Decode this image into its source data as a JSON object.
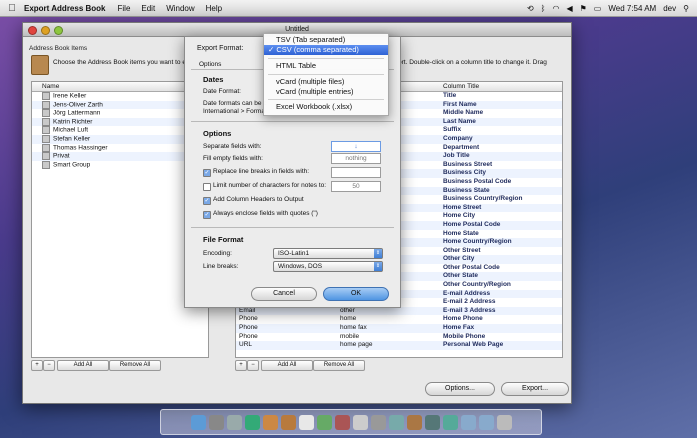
{
  "menubar": {
    "apple": "",
    "app_name": "Export Address Book",
    "items": [
      "File",
      "Edit",
      "Window",
      "Help"
    ],
    "clock": "Wed 7:54 AM",
    "user": "dev"
  },
  "window": {
    "title": "Untitled",
    "left_pane_label": "Address Book Items",
    "instructions": "Choose the Address Book items you want to ex",
    "instructions_end": "ort. Double-click on a column title to change it. Drag",
    "name_header": "Name",
    "contacts": [
      "Irene Keller",
      "Jens-Oliver Zarth",
      "Jörg Lattermann",
      "Katrin Richter",
      "Michael Luft",
      "Stefan Keller",
      "Thomas Hassinger",
      "Privat",
      "Smart Group"
    ],
    "add_all": "Add All",
    "remove_all": "Remove All",
    "plus": "+",
    "minus": "−",
    "column_title_header": "Column Title",
    "column_titles": [
      "Title",
      "First Name",
      "Middle Name",
      "Last Name",
      "Suffix",
      "Company",
      "Department",
      "Job Title",
      "Business Street",
      "Business City",
      "Business Postal Code",
      "Business State",
      "Business Country/Region",
      "Home Street",
      "Home City",
      "Home Postal Code",
      "Home State",
      "Home Country/Region",
      "Other Street",
      "Other City",
      "Other Postal Code",
      "Other State",
      "Other Country/Region",
      "E-mail Address",
      "E-mail 2 Address",
      "E-mail 3 Address",
      "Home Phone",
      "Home Fax",
      "Mobile Phone",
      "Personal Web Page"
    ],
    "lower_rows": [
      {
        "field": "Email",
        "label": "home"
      },
      {
        "field": "Email",
        "label": "other"
      },
      {
        "field": "Phone",
        "label": "home"
      },
      {
        "field": "Phone",
        "label": "home fax"
      },
      {
        "field": "Phone",
        "label": "mobile"
      },
      {
        "field": "URL",
        "label": "home page"
      }
    ],
    "options_button": "Options...",
    "export_button": "Export..."
  },
  "sheet": {
    "export_format_label": "Export Format:",
    "tab_options": "Options",
    "dates_header": "Dates",
    "date_format_label": "Date Format:",
    "date_note": "Date formats can be c",
    "date_note2": "International > Forma",
    "options_header": "Options",
    "separate_label": "Separate fields with:",
    "separate_value": "↓",
    "fill_empty_label": "Fill empty fields with:",
    "fill_empty_value": "nothing",
    "replace_breaks_label": "Replace line breaks in fields with:",
    "limit_label": "Limit number of characters for notes to:",
    "limit_value": "50",
    "add_headers_label": "Add Column Headers to Output",
    "enclose_label": "Always enclose fields with quotes (\")",
    "file_format_header": "File Format",
    "encoding_label": "Encoding:",
    "encoding_value": "ISO-Latin1",
    "line_breaks_label": "Line breaks:",
    "line_breaks_value": "Windows, DOS",
    "cancel": "Cancel",
    "ok": "OK"
  },
  "format_menu": {
    "items": [
      "TSV (Tab separated)",
      "✓ CSV (comma separated)",
      "HTML Table",
      "vCard (multiple files)",
      "vCard (multiple entries)",
      "Excel Workbook (.xlsx)"
    ],
    "selected_index": 1
  },
  "colors": {
    "selection": "#2e62d4",
    "accent": "#4f95e2"
  }
}
